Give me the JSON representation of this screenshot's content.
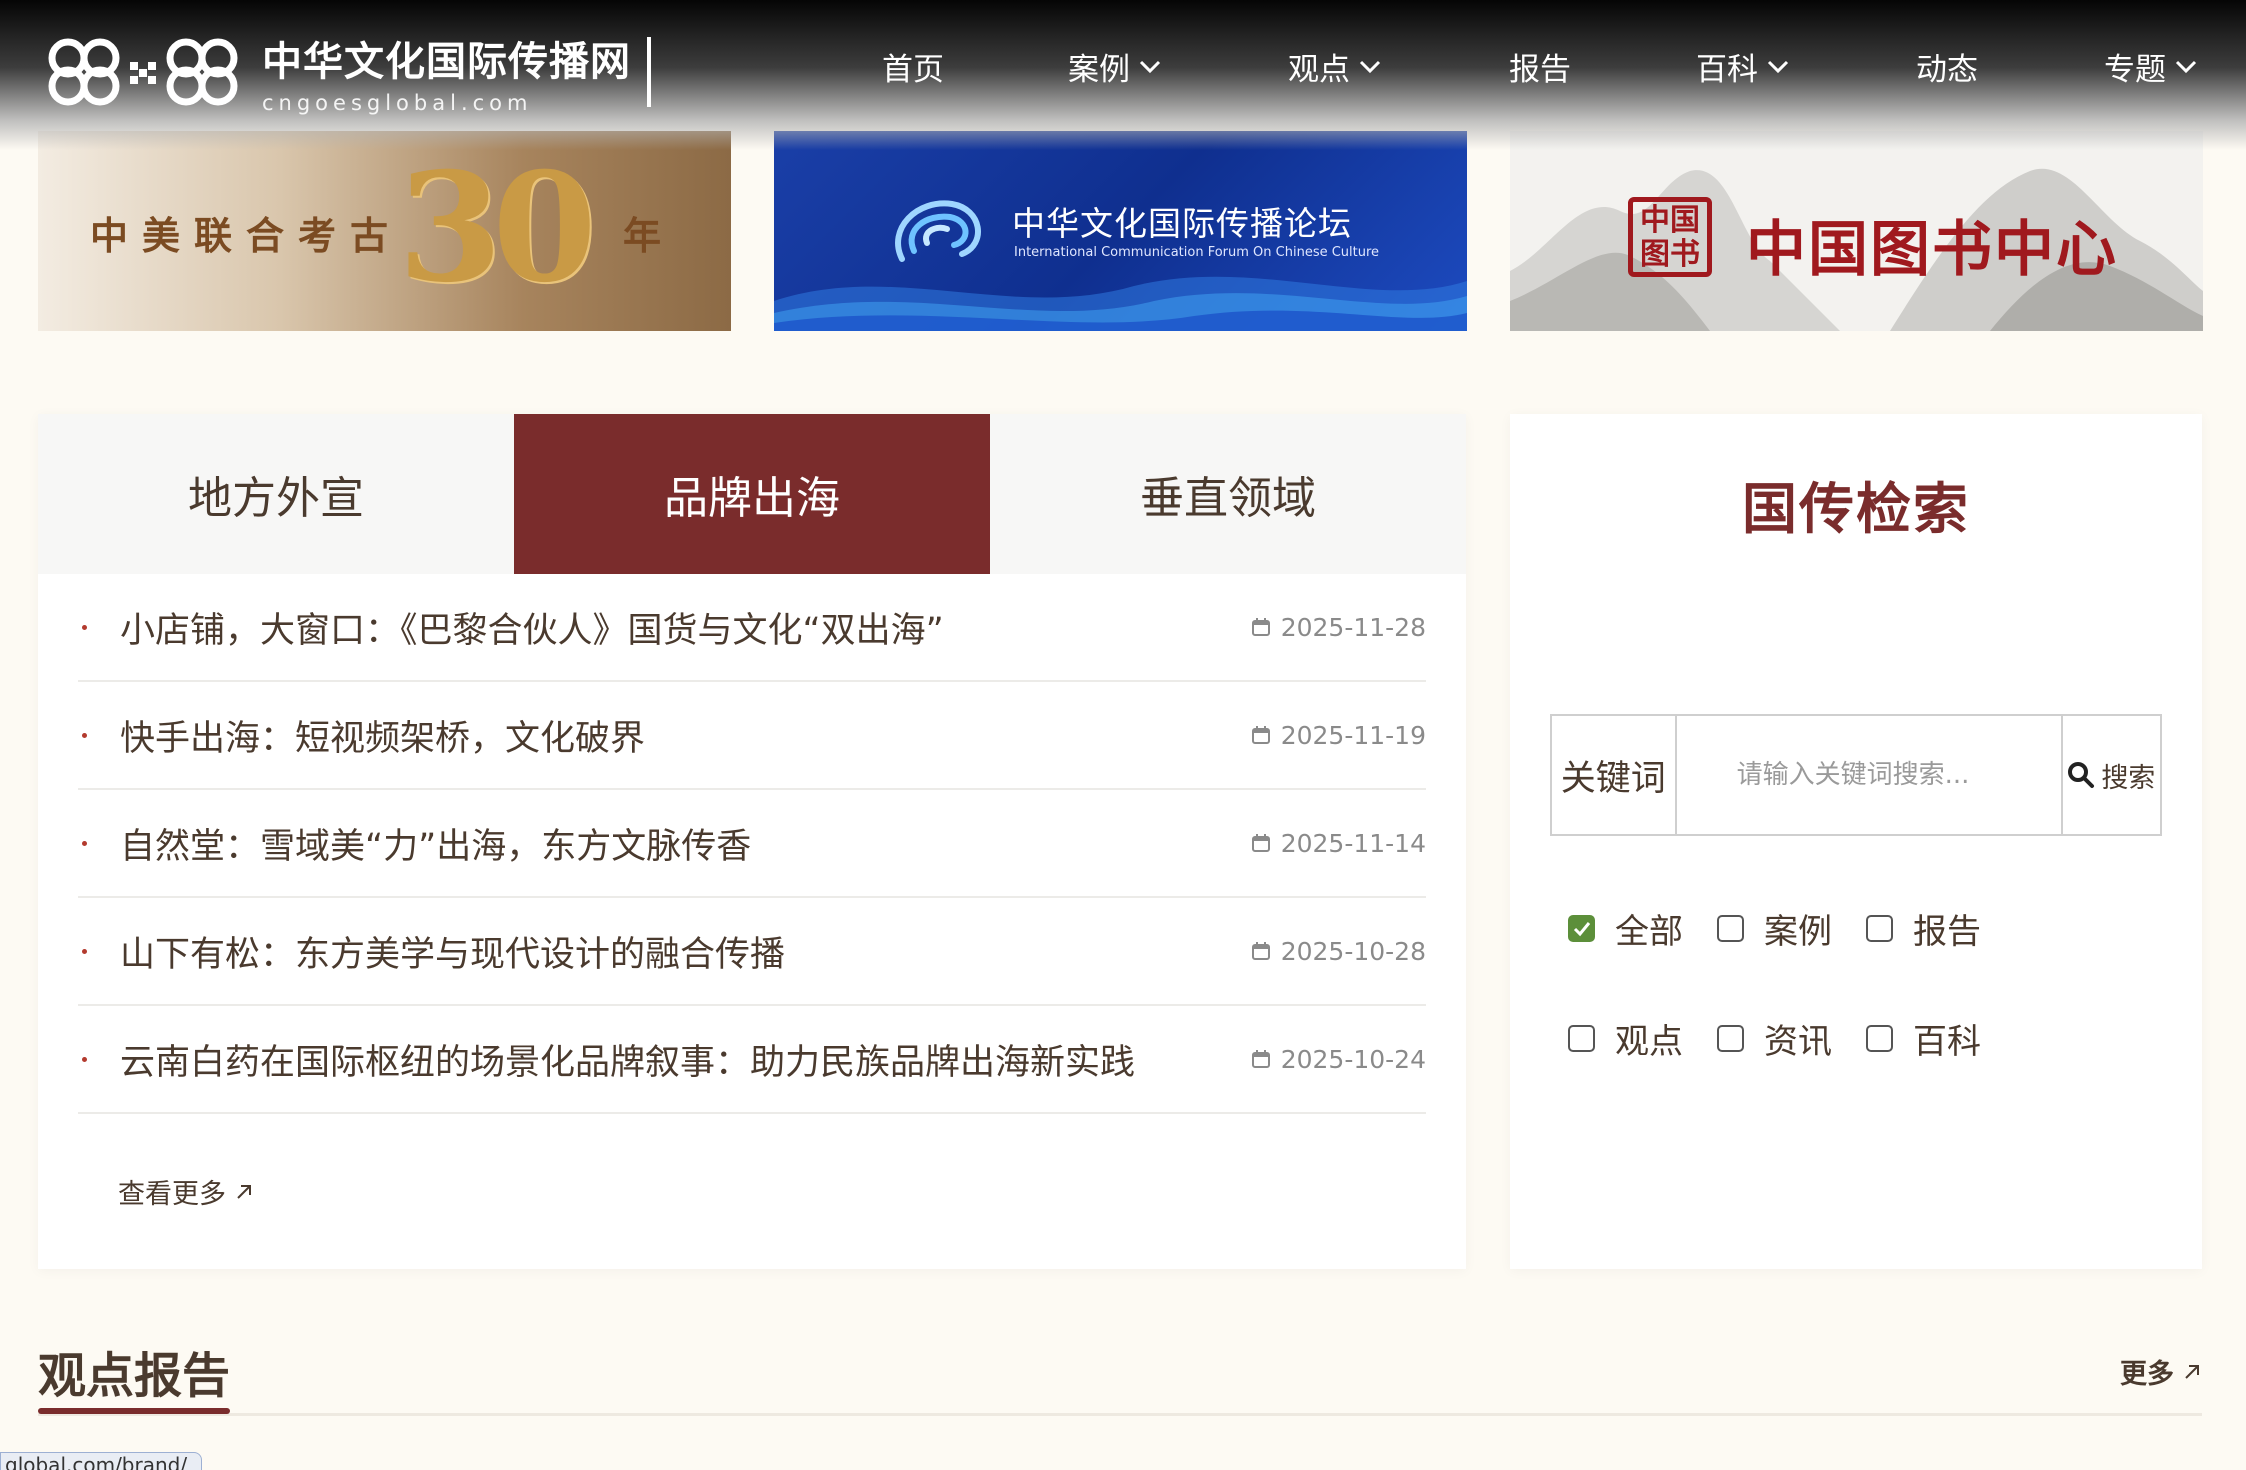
{
  "site": {
    "title": "中华文化国际传播网",
    "subtitle": "cngoesglobal.com"
  },
  "nav": [
    {
      "label": "首页",
      "has_dropdown": false
    },
    {
      "label": "案例",
      "has_dropdown": true
    },
    {
      "label": "观点",
      "has_dropdown": true
    },
    {
      "label": "报告",
      "has_dropdown": false
    },
    {
      "label": "百科",
      "has_dropdown": true
    },
    {
      "label": "动态",
      "has_dropdown": false
    },
    {
      "label": "专题",
      "has_dropdown": true
    }
  ],
  "banners": [
    {
      "text": "中美联合考古",
      "number": "30",
      "suffix": "年"
    },
    {
      "title": "中华文化国际传播论坛",
      "subtitle": "International Communication Forum On Chinese Culture"
    },
    {
      "seal": "中国图书",
      "title": "中国图书中心"
    }
  ],
  "tabs": [
    {
      "label": "地方外宣",
      "active": false
    },
    {
      "label": "品牌出海",
      "active": true
    },
    {
      "label": "垂直领域",
      "active": false
    }
  ],
  "articles": [
    {
      "title": "小店铺，大窗口：《巴黎合伙人》国货与文化“双出海”",
      "date": "2025-11-28"
    },
    {
      "title": "快手出海：短视频架桥，文化破界",
      "date": "2025-11-19"
    },
    {
      "title": "自然堂：雪域美“力”出海，东方文脉传香",
      "date": "2025-11-14"
    },
    {
      "title": "山下有松：东方美学与现代设计的融合传播",
      "date": "2025-10-28"
    },
    {
      "title": "云南白药在国际枢纽的场景化品牌叙事：助力民族品牌出海新实践",
      "date": "2025-10-24"
    }
  ],
  "view_more": "查看更多",
  "search": {
    "title": "国传检索",
    "label": "关键词",
    "placeholder": "请输入关键词搜索...",
    "button": "搜索",
    "filters": [
      {
        "label": "全部",
        "checked": true
      },
      {
        "label": "案例",
        "checked": false
      },
      {
        "label": "报告",
        "checked": false
      },
      {
        "label": "观点",
        "checked": false
      },
      {
        "label": "资讯",
        "checked": false
      },
      {
        "label": "百科",
        "checked": false
      }
    ]
  },
  "section": {
    "title": "观点报告",
    "more": "更多"
  },
  "status_url": "global.com/brand/",
  "colors": {
    "accent": "#7a2c2c",
    "text": "#4a3a2e",
    "check": "#5c8f3a",
    "background": "#fdfaf3"
  }
}
